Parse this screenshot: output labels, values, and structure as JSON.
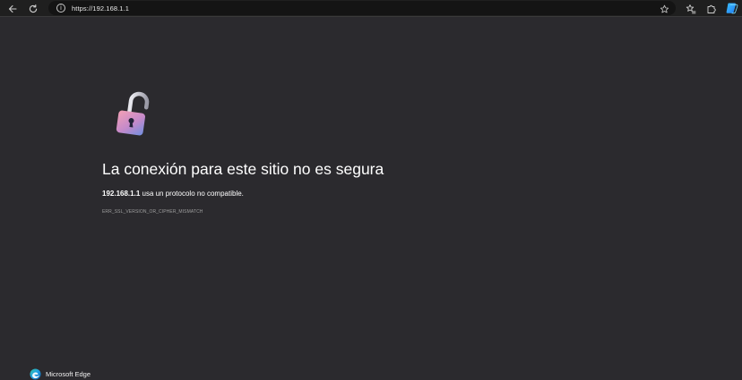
{
  "browser": {
    "address": "https://192.168.1.1",
    "icons": {
      "back": "back-arrow-icon",
      "reload": "reload-icon",
      "info": "info-icon",
      "favorite": "star-icon",
      "favorites_list": "favorites-icon",
      "copilot": "copilot-icon"
    }
  },
  "error_page": {
    "headline": "La conexión para este sitio no es segura",
    "host": "192.168.1.1",
    "detail_suffix": " usa un protocolo no compatible.",
    "error_code": "ERR_SSL_VERSION_OR_CIPHER_MISMATCH",
    "footer_brand": "Microsoft Edge"
  },
  "colors": {
    "page_background": "#2b2a2e",
    "toolbar_background": "#1f1f1f",
    "address_background": "#141414",
    "text_primary": "#ffffff",
    "text_muted": "#9e9e9e"
  }
}
